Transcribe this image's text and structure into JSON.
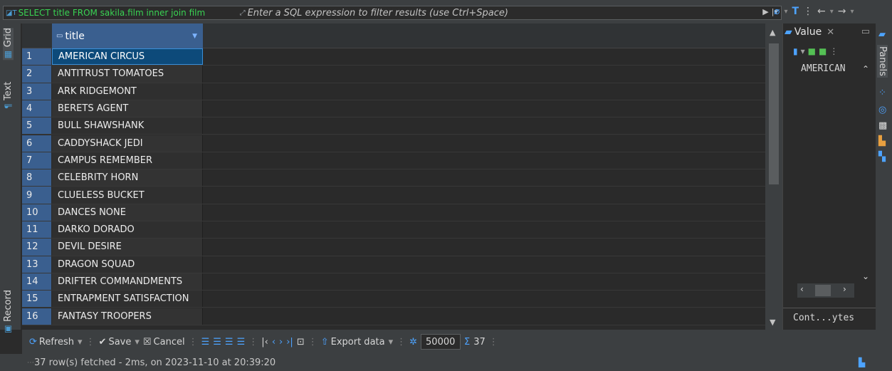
{
  "filter": {
    "sql": "SELECT title FROM sakila.film inner join film",
    "placeholder": "Enter a SQL expression to filter results (use Ctrl+Space)"
  },
  "left_tabs": {
    "grid": "Grid",
    "text": "Text",
    "record": "Record"
  },
  "columns": [
    {
      "label": "title"
    }
  ],
  "rows": [
    {
      "n": "1",
      "title": "AMERICAN CIRCUS"
    },
    {
      "n": "2",
      "title": "ANTITRUST TOMATOES"
    },
    {
      "n": "3",
      "title": "ARK RIDGEMONT"
    },
    {
      "n": "4",
      "title": "BERETS AGENT"
    },
    {
      "n": "5",
      "title": "BULL SHAWSHANK"
    },
    {
      "n": "6",
      "title": "CADDYSHACK JEDI"
    },
    {
      "n": "7",
      "title": "CAMPUS REMEMBER"
    },
    {
      "n": "8",
      "title": "CELEBRITY HORN"
    },
    {
      "n": "9",
      "title": "CLUELESS BUCKET"
    },
    {
      "n": "10",
      "title": "DANCES NONE"
    },
    {
      "n": "11",
      "title": "DARKO DORADO"
    },
    {
      "n": "12",
      "title": "DEVIL DESIRE"
    },
    {
      "n": "13",
      "title": "DRAGON SQUAD"
    },
    {
      "n": "14",
      "title": "DRIFTER COMMANDMENTS"
    },
    {
      "n": "15",
      "title": "ENTRAPMENT SATISFACTION"
    },
    {
      "n": "16",
      "title": "FANTASY TROOPERS"
    }
  ],
  "value_panel": {
    "tab_label": "Value",
    "value": "AMERICAN",
    "status": "Cont...ytes"
  },
  "right_bar": {
    "panels_label": "Panels"
  },
  "toolbar": {
    "refresh": "Refresh",
    "save": "Save",
    "cancel": "Cancel",
    "export": "Export data",
    "fetch_size": "50000",
    "row_count": "37"
  },
  "status": {
    "text": "37 row(s) fetched - 2ms, on 2023-11-10 at 20:39:20"
  },
  "colors": {
    "accent": "#3a5f8f",
    "selected": "#0d4a7a",
    "sql_text": "#39d353"
  }
}
